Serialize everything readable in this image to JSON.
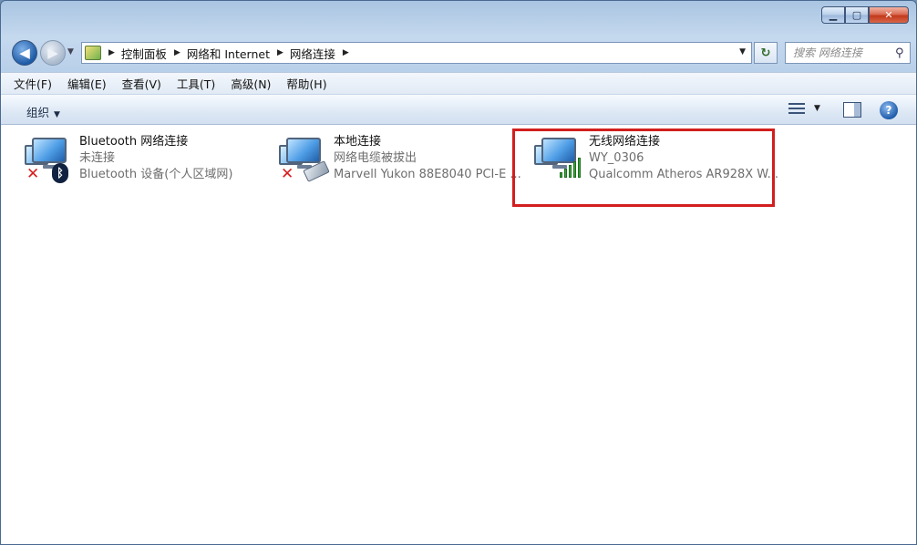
{
  "window": {
    "minimize": "▁",
    "maximize": "▢",
    "close": "✕"
  },
  "address": {
    "crumbs": [
      "控制面板",
      "网络和 Internet",
      "网络连接"
    ],
    "search_placeholder": "搜索 网络连接"
  },
  "menu": [
    "文件(F)",
    "编辑(E)",
    "查看(V)",
    "工具(T)",
    "高级(N)",
    "帮助(H)"
  ],
  "toolbar": {
    "organize_label": "组织"
  },
  "connections": [
    {
      "name": "Bluetooth 网络连接",
      "status": "未连接",
      "device": "Bluetooth 设备(个人区域网)"
    },
    {
      "name": "本地连接",
      "status": "网络电缆被拔出",
      "device": "Marvell Yukon 88E8040 PCI-E ..."
    },
    {
      "name": "无线网络连接",
      "status": "WY_0306",
      "device": "Qualcomm Atheros AR928X W..."
    }
  ],
  "colors": {
    "highlight_border": "#d21e1e",
    "status_text": "#6d6d6d"
  }
}
